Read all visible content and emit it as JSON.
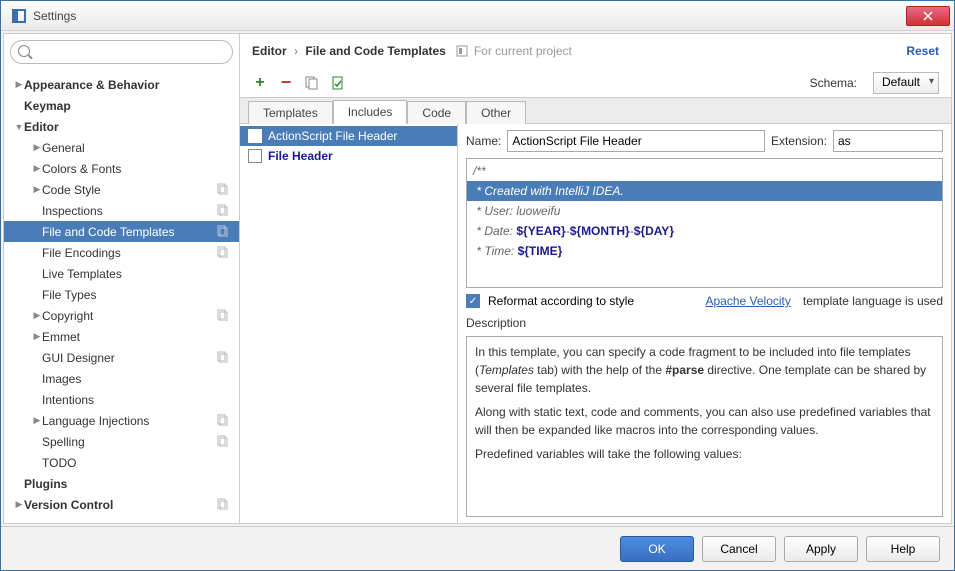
{
  "window": {
    "title": "Settings"
  },
  "sidebar": {
    "search_placeholder": "",
    "items": [
      {
        "label": "Appearance & Behavior",
        "bold": true,
        "chev": "▶",
        "lvl": 0,
        "copy": false
      },
      {
        "label": "Keymap",
        "bold": true,
        "chev": "",
        "lvl": 0,
        "copy": false
      },
      {
        "label": "Editor",
        "bold": true,
        "chev": "▼",
        "lvl": 0,
        "copy": false
      },
      {
        "label": "General",
        "bold": false,
        "chev": "▶",
        "lvl": 1,
        "copy": false
      },
      {
        "label": "Colors & Fonts",
        "bold": false,
        "chev": "▶",
        "lvl": 1,
        "copy": false
      },
      {
        "label": "Code Style",
        "bold": false,
        "chev": "▶",
        "lvl": 1,
        "copy": true
      },
      {
        "label": "Inspections",
        "bold": false,
        "chev": "",
        "lvl": 1,
        "copy": true
      },
      {
        "label": "File and Code Templates",
        "bold": false,
        "chev": "",
        "lvl": 1,
        "copy": true,
        "selected": true
      },
      {
        "label": "File Encodings",
        "bold": false,
        "chev": "",
        "lvl": 1,
        "copy": true
      },
      {
        "label": "Live Templates",
        "bold": false,
        "chev": "",
        "lvl": 1,
        "copy": false
      },
      {
        "label": "File Types",
        "bold": false,
        "chev": "",
        "lvl": 1,
        "copy": false
      },
      {
        "label": "Copyright",
        "bold": false,
        "chev": "▶",
        "lvl": 1,
        "copy": true
      },
      {
        "label": "Emmet",
        "bold": false,
        "chev": "▶",
        "lvl": 1,
        "copy": false
      },
      {
        "label": "GUI Designer",
        "bold": false,
        "chev": "",
        "lvl": 1,
        "copy": true
      },
      {
        "label": "Images",
        "bold": false,
        "chev": "",
        "lvl": 1,
        "copy": false
      },
      {
        "label": "Intentions",
        "bold": false,
        "chev": "",
        "lvl": 1,
        "copy": false
      },
      {
        "label": "Language Injections",
        "bold": false,
        "chev": "▶",
        "lvl": 1,
        "copy": true
      },
      {
        "label": "Spelling",
        "bold": false,
        "chev": "",
        "lvl": 1,
        "copy": true
      },
      {
        "label": "TODO",
        "bold": false,
        "chev": "",
        "lvl": 1,
        "copy": false
      },
      {
        "label": "Plugins",
        "bold": true,
        "chev": "",
        "lvl": 0,
        "copy": false
      },
      {
        "label": "Version Control",
        "bold": true,
        "chev": "▶",
        "lvl": 0,
        "copy": true
      }
    ]
  },
  "breadcrumb": {
    "root": "Editor",
    "leaf": "File and Code Templates",
    "scope": "For current project",
    "reset": "Reset"
  },
  "toolbar": {
    "schema_label": "Schema:",
    "schema_value": "Default"
  },
  "tabs": [
    {
      "label": "Templates",
      "active": false
    },
    {
      "label": "Includes",
      "active": true
    },
    {
      "label": "Code",
      "active": false
    },
    {
      "label": "Other",
      "active": false
    }
  ],
  "list": [
    {
      "label": "ActionScript File Header",
      "selected": true,
      "bolded": false
    },
    {
      "label": "File Header",
      "selected": false,
      "bolded": true
    }
  ],
  "detail": {
    "name_label": "Name:",
    "name_value": "ActionScript File Header",
    "ext_label": "Extension:",
    "ext_value": "as",
    "code": {
      "l1": "/**",
      "l2": " * Created with IntelliJ IDEA.",
      "l3_a": " * User: ",
      "l3_b": "luoweifu",
      "l4_a": " * Date: ",
      "l4_b": "${YEAR}",
      "l4_c": "-",
      "l4_d": "${MONTH}",
      "l4_e": "-",
      "l4_f": "${DAY}",
      "l5_a": " * Time: ",
      "l5_b": "${TIME}"
    },
    "reformat": "Reformat according to style",
    "velocity_link": "Apache Velocity",
    "velocity_tail": " template language is used",
    "desc_label": "Description",
    "desc_p1": "In this template, you can specify a code fragment to be included into file templates (Templates tab) with the help of the #parse directive. One template can be shared by several file templates.",
    "desc_p2": "Along with static text, code and comments, you can also use predefined variables that will then be expanded like macros into the corresponding values.",
    "desc_p3": "Predefined variables will take the following values:"
  },
  "buttons": {
    "ok": "OK",
    "cancel": "Cancel",
    "apply": "Apply",
    "help": "Help"
  }
}
